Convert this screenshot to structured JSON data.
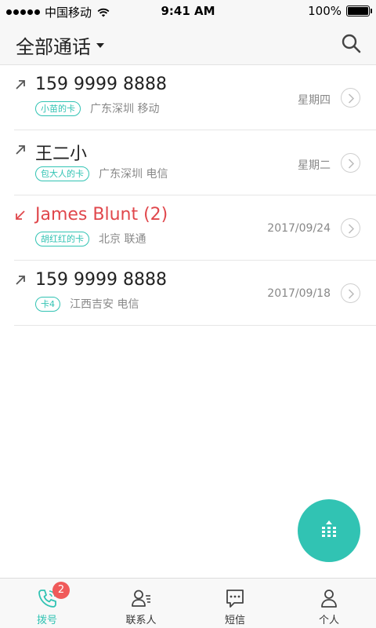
{
  "status_bar": {
    "carrier": "中国移动",
    "time": "9:41 AM",
    "battery": "100%"
  },
  "nav": {
    "title": "全部通话",
    "search_icon": "search-icon"
  },
  "calls": [
    {
      "direction": "outgoing",
      "name": "159 9999 8888",
      "sim_tag": "小苗的卡",
      "location": "广东深圳 移动",
      "date": "星期四",
      "missed": false
    },
    {
      "direction": "outgoing",
      "name": "王二小",
      "sim_tag": "包大人的卡",
      "location": "广东深圳 电信",
      "date": "星期二",
      "missed": false
    },
    {
      "direction": "incoming-missed",
      "name": "James Blunt (2)",
      "sim_tag": "胡红红的卡",
      "location": "北京 联通",
      "date": "2017/09/24",
      "missed": true
    },
    {
      "direction": "outgoing",
      "name": "159 9999 8888",
      "sim_tag": "卡4",
      "location": "江西吉安 电信",
      "date": "2017/09/18",
      "missed": false
    }
  ],
  "fab": {
    "icon": "dialpad-icon"
  },
  "tabs": [
    {
      "label": "拨号",
      "icon": "phone-icon",
      "active": true,
      "badge": "2"
    },
    {
      "label": "联系人",
      "icon": "contacts-icon",
      "active": false
    },
    {
      "label": "短信",
      "icon": "message-icon",
      "active": false
    },
    {
      "label": "个人",
      "icon": "person-icon",
      "active": false
    }
  ],
  "colors": {
    "accent": "#31c3b3",
    "missed": "#e0474c",
    "badge": "#f05a5a"
  }
}
